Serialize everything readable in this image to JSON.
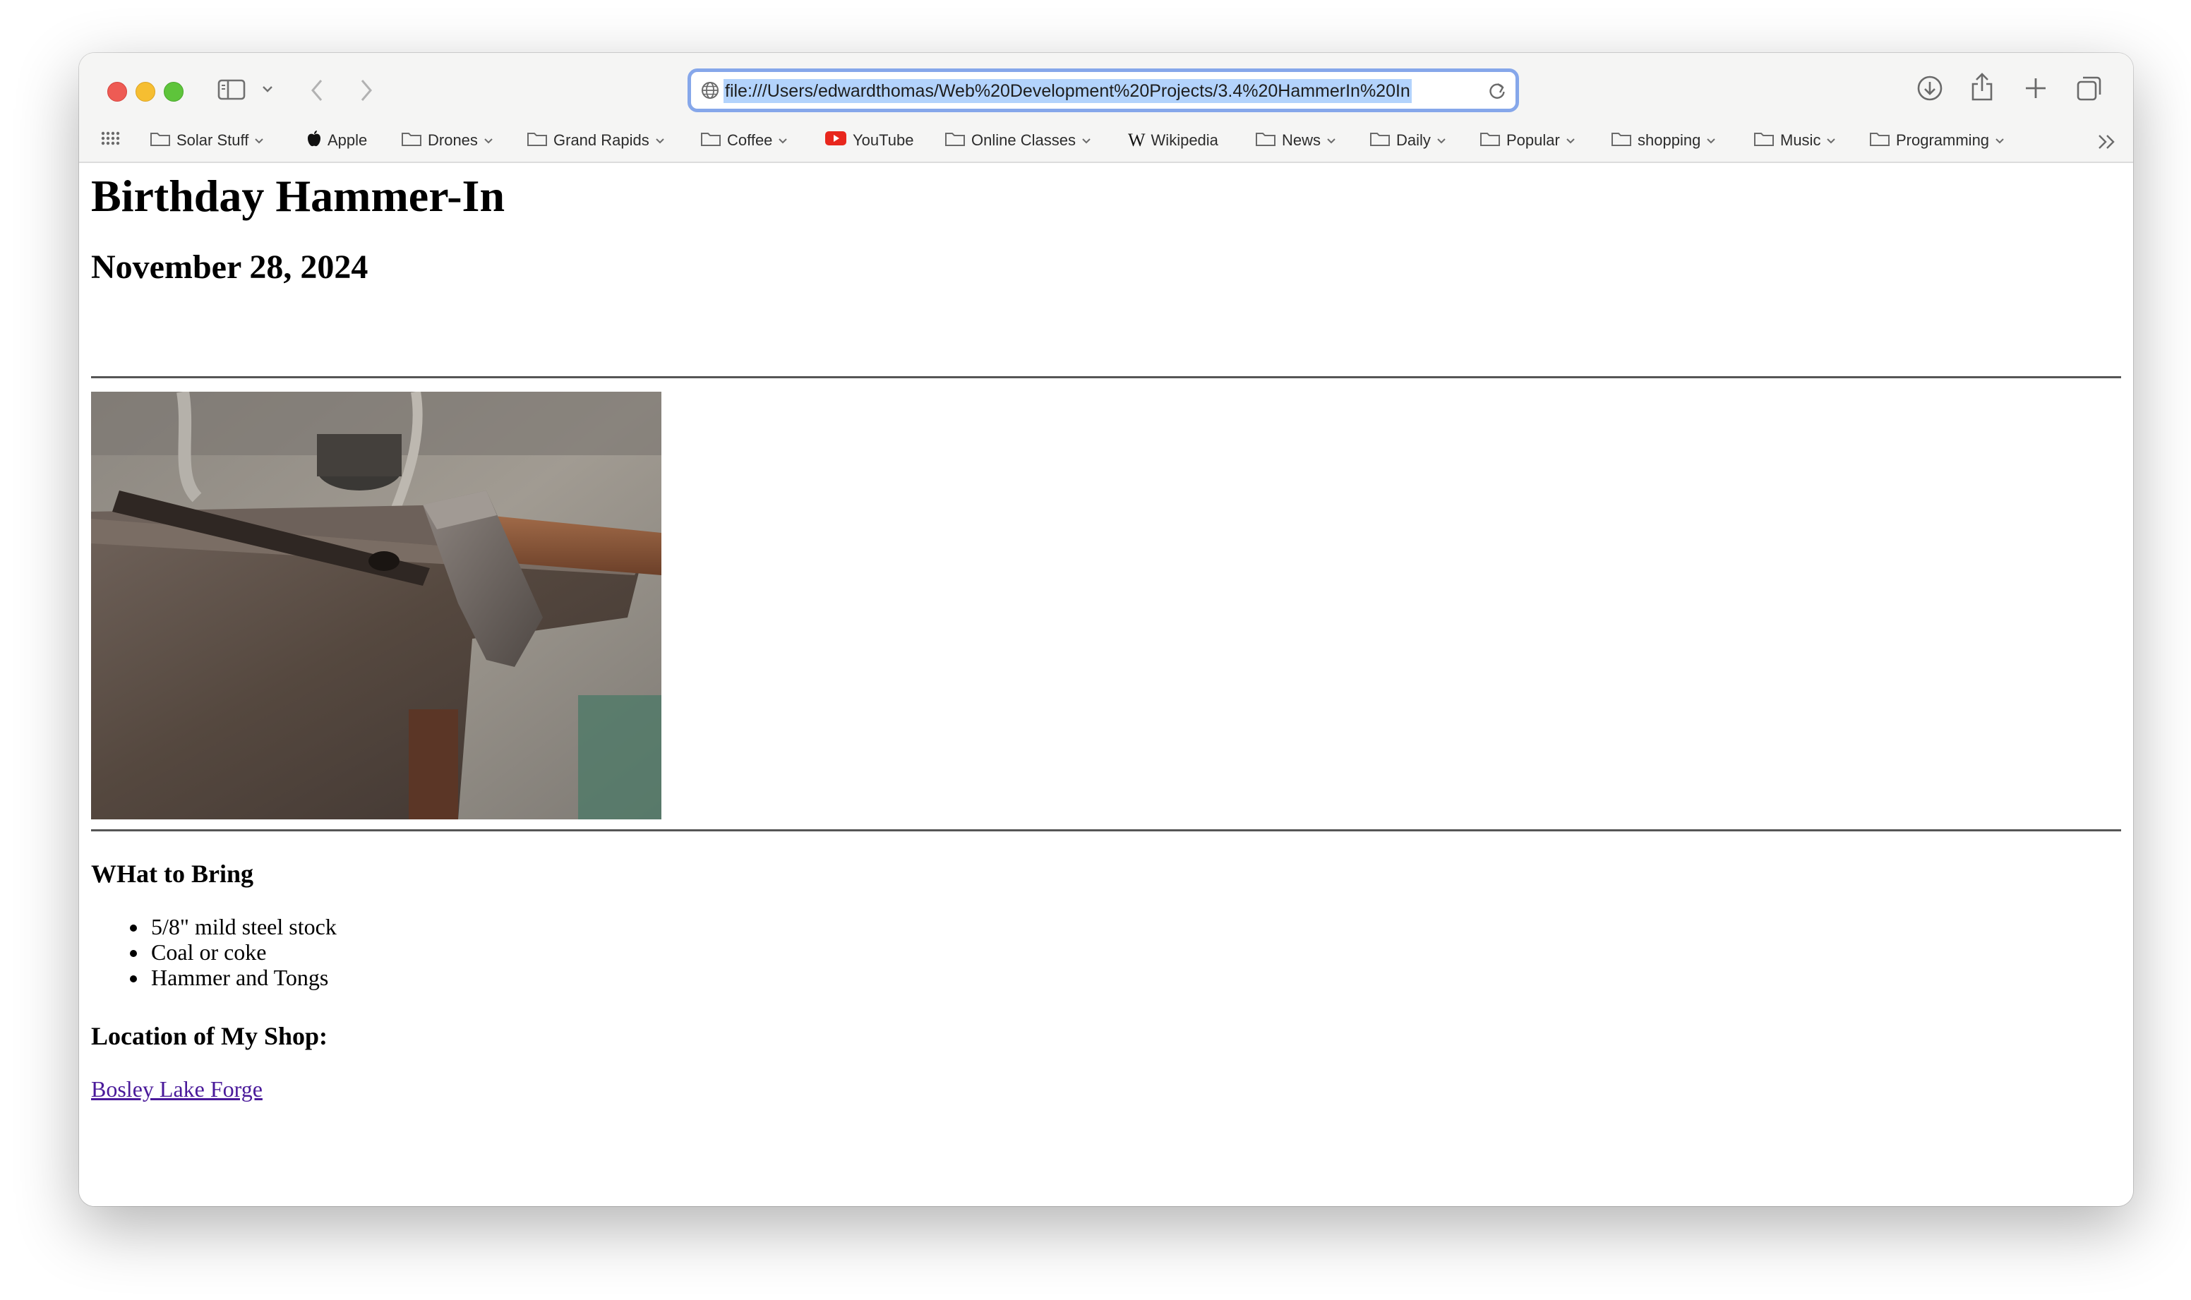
{
  "browser": {
    "url": "file:///Users/edwardthomas/Web%20Development%20Projects/3.4%20HammerIn%20In",
    "colors": {
      "close": "#ee5b54",
      "minimize": "#f6be31",
      "zoom": "#5ec43b",
      "address_focus": "#86a7ea",
      "url_selection": "#b3d3fc",
      "youtube": "#e8271d"
    },
    "bookmarks": [
      {
        "label": "Solar Stuff",
        "icon": "folder-icon",
        "dropdown": true
      },
      {
        "label": "Apple",
        "icon": "apple-logo-icon",
        "dropdown": false
      },
      {
        "label": "Drones",
        "icon": "folder-icon",
        "dropdown": true
      },
      {
        "label": "Grand Rapids",
        "icon": "folder-icon",
        "dropdown": true
      },
      {
        "label": "Coffee",
        "icon": "folder-icon",
        "dropdown": true
      },
      {
        "label": "YouTube",
        "icon": "youtube-logo-icon",
        "dropdown": false
      },
      {
        "label": "Online Classes",
        "icon": "folder-icon",
        "dropdown": true
      },
      {
        "label": "Wikipedia",
        "icon": "wikipedia-logo-icon",
        "dropdown": false
      },
      {
        "label": "News",
        "icon": "folder-icon",
        "dropdown": true
      },
      {
        "label": "Daily",
        "icon": "folder-icon",
        "dropdown": true
      },
      {
        "label": "Popular",
        "icon": "folder-icon",
        "dropdown": true
      },
      {
        "label": "shopping",
        "icon": "folder-icon",
        "dropdown": true
      },
      {
        "label": "Music",
        "icon": "folder-icon",
        "dropdown": true
      },
      {
        "label": "Programming",
        "icon": "folder-icon",
        "dropdown": true
      }
    ],
    "wikipedia_glyph": "W"
  },
  "page": {
    "title": "Birthday Hammer-In",
    "date": "November 28, 2024",
    "bring_heading": "WHat to Bring",
    "bring_items": [
      "5/8\" mild steel stock",
      "Coal or coke",
      "Hammer and Tongs"
    ],
    "location_heading": "Location of My Shop:",
    "location_link": "Bosley Lake Forge"
  }
}
